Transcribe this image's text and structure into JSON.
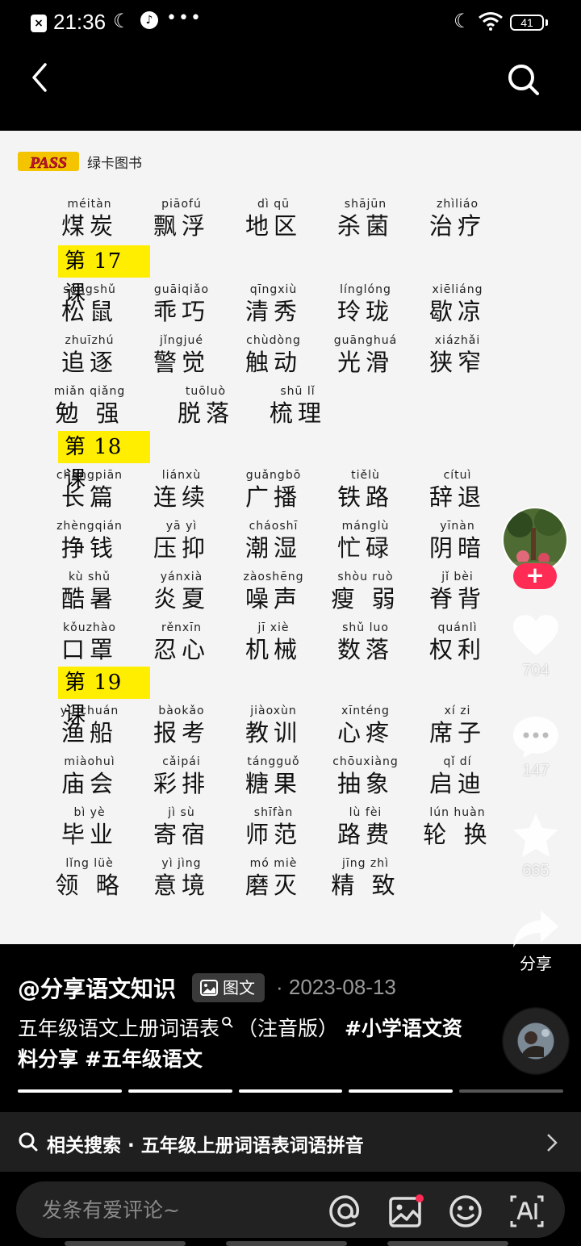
{
  "status_bar": {
    "time": "21:36",
    "battery": "41"
  },
  "content": {
    "brand": {
      "logo": "PASS",
      "name": "绿卡图书"
    },
    "top_row": [
      {
        "py": "méitàn",
        "hz": "煤炭"
      },
      {
        "py": "piāofú",
        "hz": "飘浮"
      },
      {
        "py": "dì qū",
        "hz": "地区"
      },
      {
        "py": "shājūn",
        "hz": "杀菌"
      },
      {
        "py": "zhìliáo",
        "hz": "治疗"
      }
    ],
    "lessons": [
      {
        "title": "第 17 课",
        "rows": [
          [
            {
              "py": "sōngshǔ",
              "hz": "松鼠"
            },
            {
              "py": "guāiqiǎo",
              "hz": "乖巧"
            },
            {
              "py": "qīngxiù",
              "hz": "清秀"
            },
            {
              "py": "línglóng",
              "hz": "玲珑"
            },
            {
              "py": "xiēliáng",
              "hz": "歇凉"
            }
          ],
          [
            {
              "py": "zhuīzhú",
              "hz": "追逐"
            },
            {
              "py": "jǐngjué",
              "hz": "警觉"
            },
            {
              "py": "chùdòng",
              "hz": "触动"
            },
            {
              "py": "guānghuá",
              "hz": "光滑"
            },
            {
              "py": "xiázhǎi",
              "hz": "狭窄"
            }
          ],
          [
            {
              "py": "miǎn qiǎng",
              "hz": "勉 强"
            },
            {
              "py": "tuōluò",
              "hz": "脱落"
            },
            {
              "py": "shū lǐ",
              "hz": "梳理"
            }
          ]
        ]
      },
      {
        "title": "第 18 课",
        "rows": [
          [
            {
              "py": "chángpiān",
              "hz": "长篇"
            },
            {
              "py": "liánxù",
              "hz": "连续"
            },
            {
              "py": "guǎngbō",
              "hz": "广播"
            },
            {
              "py": "tiělù",
              "hz": "铁路"
            },
            {
              "py": "cítuì",
              "hz": "辞退"
            }
          ],
          [
            {
              "py": "zhèngqián",
              "hz": "挣钱"
            },
            {
              "py": "yā yì",
              "hz": "压抑"
            },
            {
              "py": "cháoshī",
              "hz": "潮湿"
            },
            {
              "py": "mánglù",
              "hz": "忙碌"
            },
            {
              "py": "yīnàn",
              "hz": "阴暗"
            }
          ],
          [
            {
              "py": "kù shǔ",
              "hz": "酷暑"
            },
            {
              "py": "yánxià",
              "hz": "炎夏"
            },
            {
              "py": "zàoshēng",
              "hz": "噪声"
            },
            {
              "py": "shòu ruò",
              "hz": "瘦 弱"
            },
            {
              "py": "jǐ bèi",
              "hz": "脊背"
            }
          ],
          [
            {
              "py": "kǒuzhào",
              "hz": "口罩"
            },
            {
              "py": "rěnxīn",
              "hz": "忍心"
            },
            {
              "py": "jī xiè",
              "hz": "机械"
            },
            {
              "py": "shǔ luo",
              "hz": "数落"
            },
            {
              "py": "quánlì",
              "hz": "权利"
            }
          ]
        ]
      },
      {
        "title": "第 19 课",
        "rows": [
          [
            {
              "py": "yú chuán",
              "hz": "渔船"
            },
            {
              "py": "bàokǎo",
              "hz": "报考"
            },
            {
              "py": "jiàoxùn",
              "hz": "教训"
            },
            {
              "py": "xīnténg",
              "hz": "心疼"
            },
            {
              "py": "xí zi",
              "hz": "席子"
            }
          ],
          [
            {
              "py": "miàohuì",
              "hz": "庙会"
            },
            {
              "py": "cǎipái",
              "hz": "彩排"
            },
            {
              "py": "tángguǒ",
              "hz": "糖果"
            },
            {
              "py": "chōuxiàng",
              "hz": "抽象"
            },
            {
              "py": "qǐ dí",
              "hz": "启迪"
            }
          ],
          [
            {
              "py": "bì yè",
              "hz": "毕业"
            },
            {
              "py": "jì sù",
              "hz": "寄宿"
            },
            {
              "py": "shīfàn",
              "hz": "师范"
            },
            {
              "py": "lù fèi",
              "hz": "路费"
            },
            {
              "py": "lún huàn",
              "hz": "轮 换"
            }
          ],
          [
            {
              "py": "lǐng lüè",
              "hz": "领 略"
            },
            {
              "py": "yì jìng",
              "hz": "意境"
            },
            {
              "py": "mó miè",
              "hz": "磨灭"
            },
            {
              "py": "jīng zhì",
              "hz": "精 致"
            }
          ]
        ]
      }
    ]
  },
  "actions": {
    "follow": "+",
    "likes": "704",
    "comments": "147",
    "favorites": "665",
    "share_label": "分享"
  },
  "post": {
    "author": "@分享语文知识",
    "badge": "图文",
    "date": "· 2023-08-13",
    "desc_main": "五年级语文上册词语表",
    "desc_note": "（注音版）",
    "hashtag1": "#小学语文资料分享",
    "hashtag2": "#五年级语文",
    "progress_total": 5,
    "progress_current": 4
  },
  "related": {
    "text": "相关搜索 · 五年级上册词语表词语拼音"
  },
  "comment": {
    "placeholder": "发条有爱评论~"
  },
  "colors": {
    "accent": "#fe2c55",
    "highlight": "#ffee00"
  }
}
